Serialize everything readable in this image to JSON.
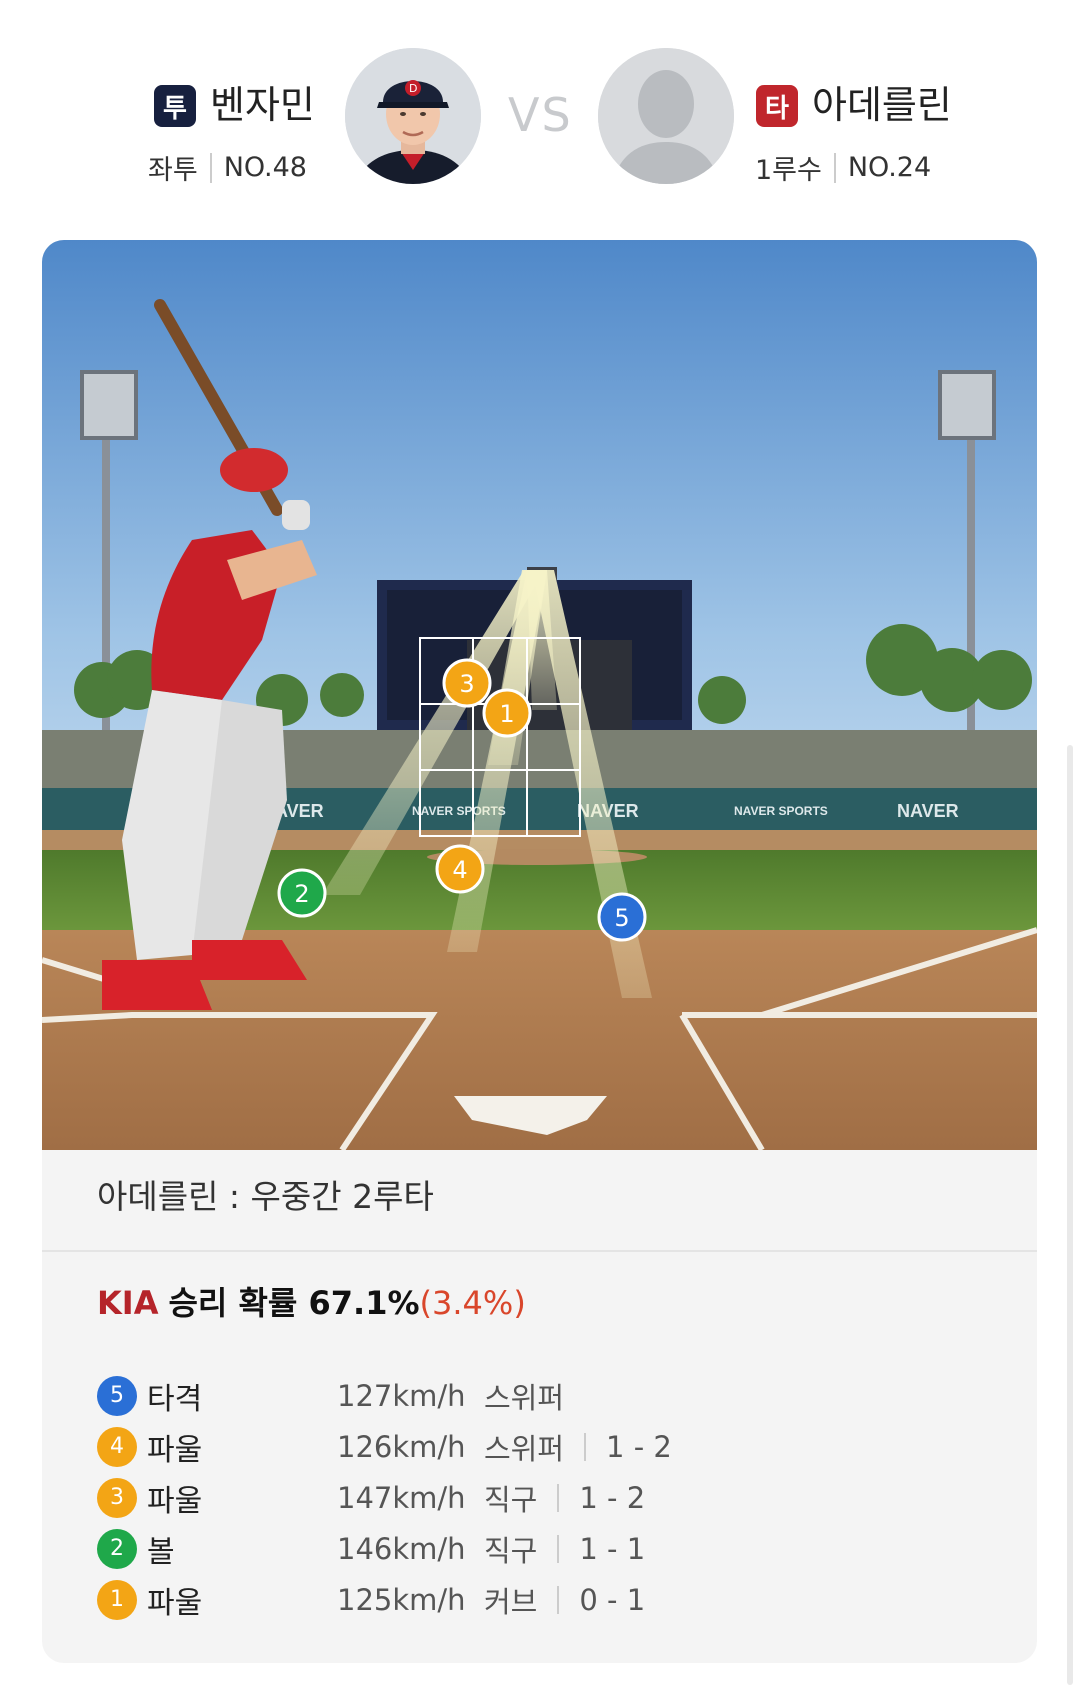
{
  "pitcher": {
    "role_badge": "투",
    "name": "벤자민",
    "hand": "좌투",
    "number": "NO.48",
    "badge_color": "#17203f"
  },
  "vs_label": "VS",
  "batter": {
    "role_badge": "타",
    "name": "아데를린",
    "position": "1루수",
    "number": "NO.24",
    "badge_color": "#c0262c"
  },
  "scene": {
    "ad_boards": [
      "NAVER",
      "NAVER SPORTS",
      "NAVER",
      "NAVER SPORTS",
      "NAVER"
    ],
    "markers": [
      "1",
      "2",
      "3",
      "4",
      "5"
    ]
  },
  "at_bat_result": "아데를린 : 우중간 2루타",
  "win_probability": {
    "team": "KIA",
    "label": "승리 확률 67.1%",
    "delta": "(3.4%)"
  },
  "pitches": [
    {
      "num": "5",
      "result": "타격",
      "speed": "127km/h",
      "type": "스위퍼",
      "count": "",
      "color": "#2a6fd6"
    },
    {
      "num": "4",
      "result": "파울",
      "speed": "126km/h",
      "type": "스위퍼",
      "count": "1 - 2",
      "color": "#f3a515"
    },
    {
      "num": "3",
      "result": "파울",
      "speed": "147km/h",
      "type": "직구",
      "count": "1 - 2",
      "color": "#f3a515"
    },
    {
      "num": "2",
      "result": "볼",
      "speed": "146km/h",
      "type": "직구",
      "count": "1 - 1",
      "color": "#1fa84a"
    },
    {
      "num": "1",
      "result": "파울",
      "speed": "125km/h",
      "type": "커브",
      "count": "0 - 1",
      "color": "#f3a515"
    }
  ]
}
